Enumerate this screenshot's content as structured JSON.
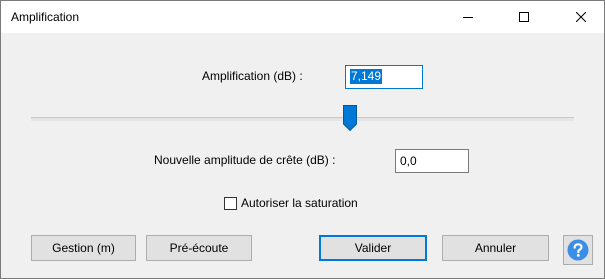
{
  "window": {
    "title": "Amplification",
    "controls": {
      "minimize_icon": "minimize-icon",
      "maximize_icon": "maximize-icon",
      "close_icon": "close-icon"
    }
  },
  "amplification": {
    "label": "Amplification (dB) :",
    "value": "7,149"
  },
  "slider": {
    "level_db": 7.149
  },
  "peak": {
    "label": "Nouvelle amplitude de crête (dB) :",
    "value": "0,0"
  },
  "clipping": {
    "label": "Autoriser la saturation",
    "checked": false
  },
  "buttons": {
    "manage": "Gestion (m)",
    "preview": "Pré-écoute",
    "ok": "Valider",
    "cancel": "Annuler",
    "help_icon": "help-icon"
  },
  "colors": {
    "accent": "#0078d7",
    "help": "#3a8ee6"
  }
}
